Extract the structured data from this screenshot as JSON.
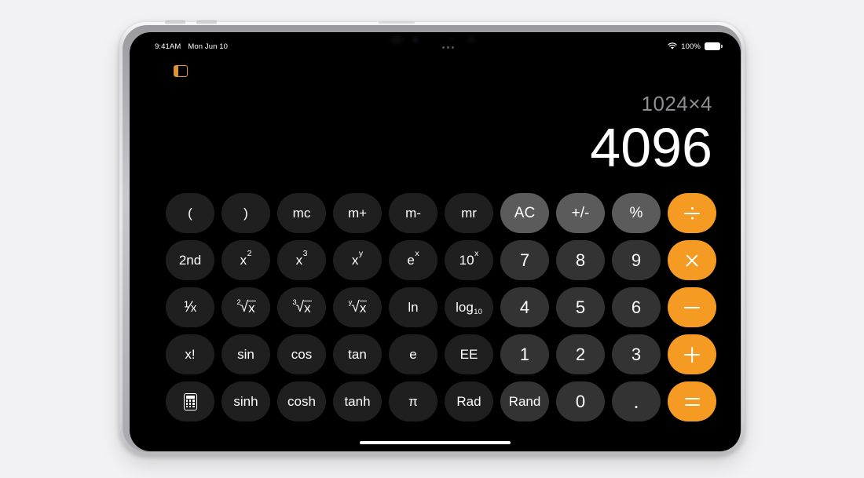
{
  "device": {
    "name": "ipad-tablet",
    "screen_background": "#000000"
  },
  "status_bar": {
    "time": "9:41AM",
    "date": "Mon Jun 10",
    "multitasking_label": "•••",
    "wifi_icon": "wifi-icon",
    "battery_percent": "100%",
    "battery_icon": "battery-icon"
  },
  "sidebar_toggle": {
    "icon": "sidebar-toggle-icon",
    "color": "#e2912f"
  },
  "app": {
    "name": "Calculator",
    "display": {
      "expression": "1024×4",
      "result": "4096"
    },
    "colors": {
      "accent": "#f59a22",
      "number_key": "#333333",
      "function_key": "#1f1f1f",
      "utility_key": "#5b5b5b",
      "text": "#ffffff",
      "expression_text": "#8e8e92"
    },
    "keypad": {
      "rows": [
        [
          {
            "name": "open-paren",
            "label": "(",
            "type": "fn"
          },
          {
            "name": "close-paren",
            "label": ")",
            "type": "fn"
          },
          {
            "name": "memory-clear",
            "label": "mc",
            "type": "fn"
          },
          {
            "name": "memory-add",
            "label": "m+",
            "type": "fn"
          },
          {
            "name": "memory-sub",
            "label": "m-",
            "type": "fn"
          },
          {
            "name": "memory-recall",
            "label": "mr",
            "type": "fn"
          },
          {
            "name": "all-clear",
            "label": "AC",
            "type": "util"
          },
          {
            "name": "sign-toggle",
            "label": "+/-",
            "type": "util"
          },
          {
            "name": "percent",
            "label": "%",
            "type": "util"
          },
          {
            "name": "divide",
            "label": "÷",
            "type": "accent"
          }
        ],
        [
          {
            "name": "second-functions",
            "label": "2nd",
            "type": "fn"
          },
          {
            "name": "x-squared",
            "label": "x²",
            "type": "fn"
          },
          {
            "name": "x-cubed",
            "label": "x³",
            "type": "fn"
          },
          {
            "name": "x-to-y",
            "label": "xʸ",
            "type": "fn"
          },
          {
            "name": "e-to-x",
            "label": "eˣ",
            "type": "fn"
          },
          {
            "name": "ten-to-x",
            "label": "10ˣ",
            "type": "fn"
          },
          {
            "name": "digit-7",
            "label": "7",
            "type": "num"
          },
          {
            "name": "digit-8",
            "label": "8",
            "type": "num"
          },
          {
            "name": "digit-9",
            "label": "9",
            "type": "num"
          },
          {
            "name": "multiply",
            "label": "×",
            "type": "accent"
          }
        ],
        [
          {
            "name": "reciprocal",
            "label": "1/x",
            "type": "fn"
          },
          {
            "name": "square-root",
            "label": "²√x",
            "type": "fn"
          },
          {
            "name": "cube-root",
            "label": "³√x",
            "type": "fn"
          },
          {
            "name": "y-root",
            "label": "ʸ√x",
            "type": "fn"
          },
          {
            "name": "natural-log",
            "label": "ln",
            "type": "fn"
          },
          {
            "name": "log-base-10",
            "label": "log₁₀",
            "type": "fn"
          },
          {
            "name": "digit-4",
            "label": "4",
            "type": "num"
          },
          {
            "name": "digit-5",
            "label": "5",
            "type": "num"
          },
          {
            "name": "digit-6",
            "label": "6",
            "type": "num"
          },
          {
            "name": "subtract",
            "label": "−",
            "type": "accent"
          }
        ],
        [
          {
            "name": "factorial",
            "label": "x!",
            "type": "fn"
          },
          {
            "name": "sine",
            "label": "sin",
            "type": "fn"
          },
          {
            "name": "cosine",
            "label": "cos",
            "type": "fn"
          },
          {
            "name": "tangent",
            "label": "tan",
            "type": "fn"
          },
          {
            "name": "euler-number",
            "label": "e",
            "type": "fn"
          },
          {
            "name": "exponent-ee",
            "label": "EE",
            "type": "fn"
          },
          {
            "name": "digit-1",
            "label": "1",
            "type": "num"
          },
          {
            "name": "digit-2",
            "label": "2",
            "type": "num"
          },
          {
            "name": "digit-3",
            "label": "3",
            "type": "num"
          },
          {
            "name": "add",
            "label": "+",
            "type": "accent"
          }
        ],
        [
          {
            "name": "basic-calculator-mode",
            "label": "calculator-icon",
            "type": "fn"
          },
          {
            "name": "hyperbolic-sine",
            "label": "sinh",
            "type": "fn"
          },
          {
            "name": "hyperbolic-cosine",
            "label": "cosh",
            "type": "fn"
          },
          {
            "name": "hyperbolic-tangent",
            "label": "tanh",
            "type": "fn"
          },
          {
            "name": "pi",
            "label": "π",
            "type": "fn"
          },
          {
            "name": "radians",
            "label": "Rad",
            "type": "fn"
          },
          {
            "name": "random",
            "label": "Rand",
            "type": "num"
          },
          {
            "name": "digit-0",
            "label": "0",
            "type": "num"
          },
          {
            "name": "decimal-point",
            "label": ".",
            "type": "num"
          },
          {
            "name": "equals",
            "label": "=",
            "type": "accent"
          }
        ]
      ]
    }
  }
}
